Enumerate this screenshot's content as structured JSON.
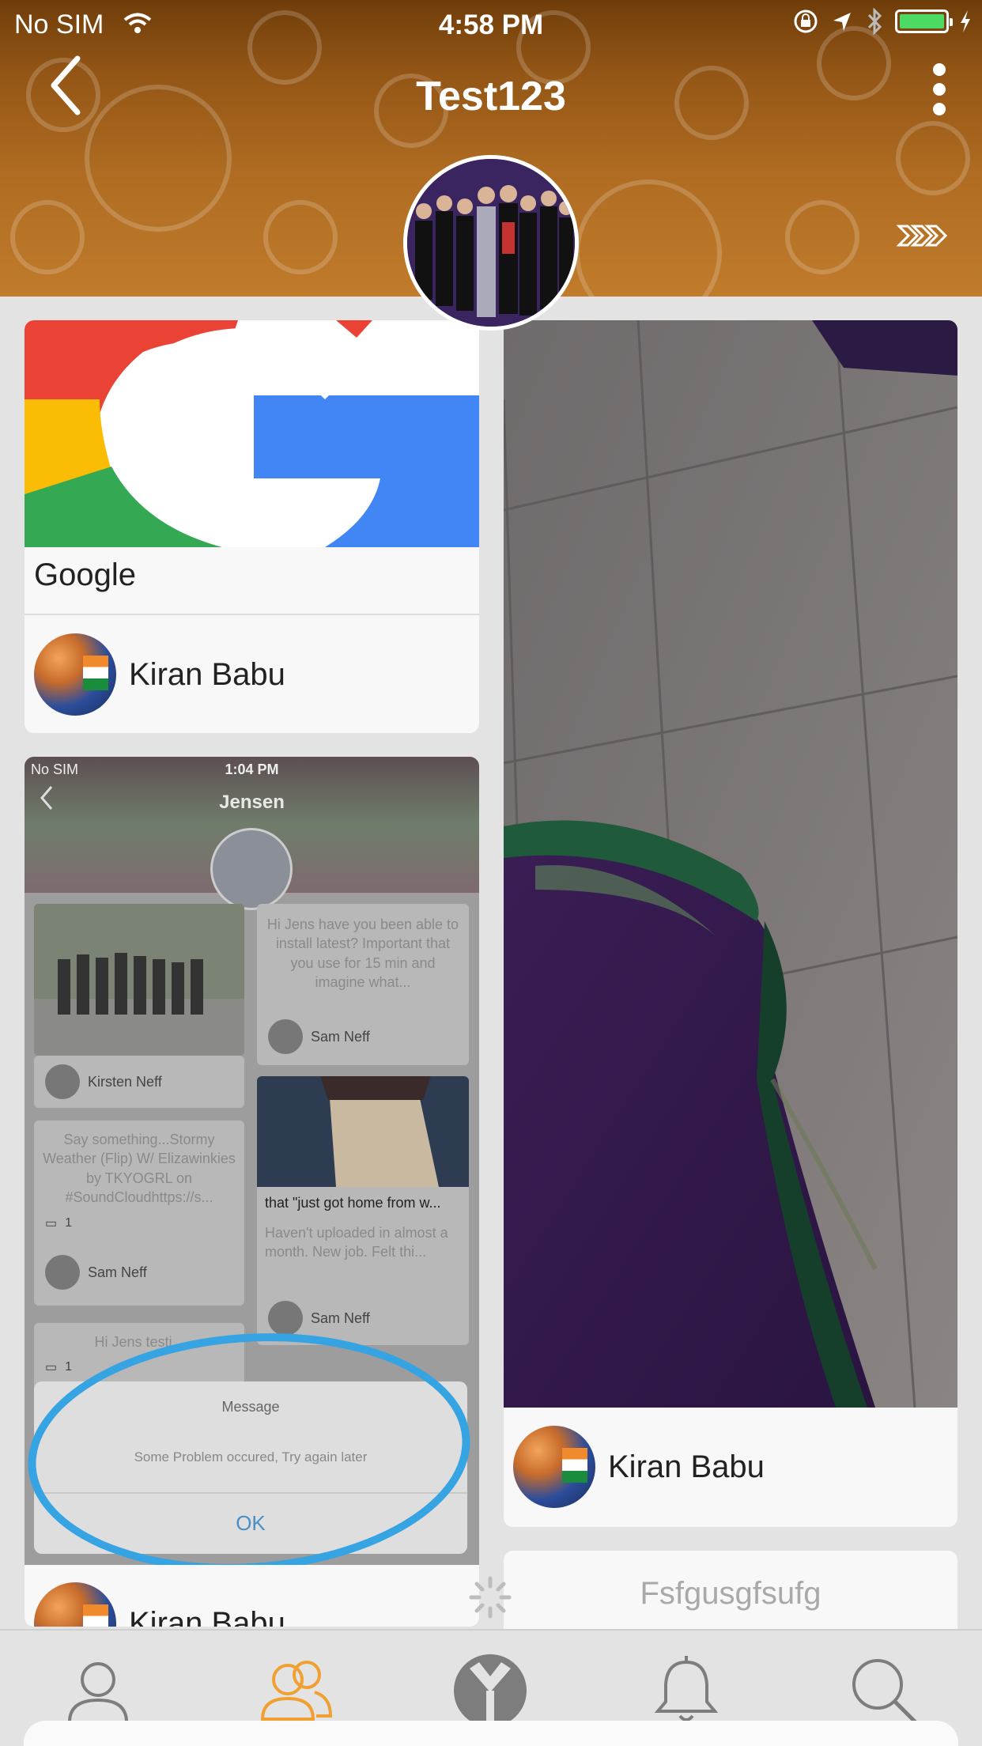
{
  "status_bar": {
    "carrier": "No SIM",
    "time": "4:58 PM"
  },
  "header": {
    "title": "Test123"
  },
  "feed": {
    "card_google": {
      "caption": "Google",
      "user": "Kiran Babu"
    },
    "card_screenshot": {
      "embedded": {
        "carrier": "No SIM",
        "time": "1:04 PM",
        "title": "Jensen",
        "post1_text": "Hi  Jens have you been able to install latest? Important that you use for 15 min and imagine what...",
        "post1_user": "Sam Neff",
        "post2_user": "Kirsten Neff",
        "post3_text": "Say something...Stormy Weather (Flip) W/ Elizawinkies by TKYOGRL on #SoundCloudhttps://s...",
        "post3_count": "1",
        "post3_user": "Sam Neff",
        "post4_title": "that \"just got home from w...",
        "post4_text": "Haven't uploaded in almost a month. New job. Felt thi...",
        "post4_user": "Sam Neff",
        "post5_text": "Hi Jens testi...",
        "post5_count": "1",
        "alert_title": "Message",
        "alert_body": "Some Problem occured, Try again later",
        "alert_button": "OK"
      },
      "user": "Kiran Babu"
    },
    "card_photo": {
      "user": "Kiran Babu"
    },
    "card_text": {
      "text": "Fsfgusgfsufg"
    }
  },
  "tabbar": {
    "tabs": [
      "profile-icon",
      "friends-icon",
      "home-logo-icon",
      "notifications-icon",
      "search-icon"
    ],
    "active_color": "#f0a030",
    "inactive_color": "#7d7d7d"
  },
  "colors": {
    "header_brown": "#945616",
    "battery_green": "#4cd964"
  }
}
